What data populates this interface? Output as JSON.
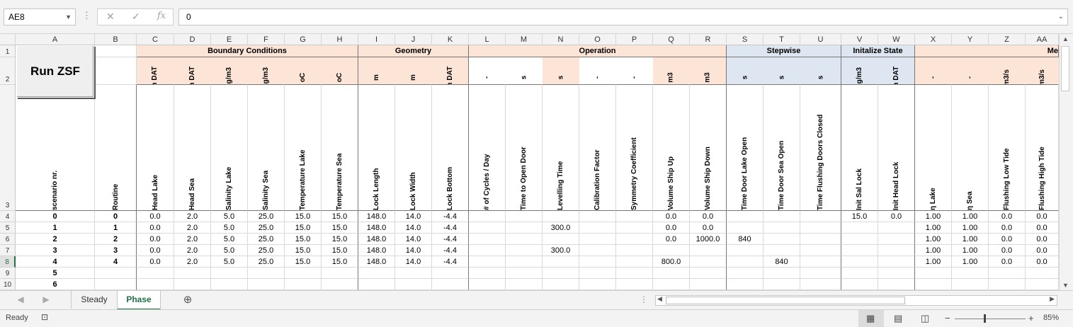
{
  "namebox": "AE8",
  "formula_value": "0",
  "fx_label": "fx",
  "columns": [
    "A",
    "B",
    "C",
    "D",
    "E",
    "F",
    "G",
    "H",
    "I",
    "J",
    "K",
    "L",
    "M",
    "N",
    "O",
    "P",
    "Q",
    "R",
    "S",
    "T",
    "U",
    "V",
    "W",
    "X",
    "Y",
    "Z",
    "AA"
  ],
  "row_numbers": [
    "1",
    "2",
    "3",
    "4",
    "5",
    "6",
    "7",
    "8",
    "9",
    "10"
  ],
  "run_button": "Run ZSF",
  "groups": [
    {
      "label": "Boundary Conditions"
    },
    {
      "label": "Geometry"
    },
    {
      "label": "Operation"
    },
    {
      "label": "Stepwise"
    },
    {
      "label": "Initalize State"
    },
    {
      "label": "Me"
    }
  ],
  "units": [
    "m DAT",
    "m DAT",
    "kg/m3",
    "kg/m3",
    "oC",
    "oC",
    "m",
    "m",
    "m DAT",
    "-",
    "s",
    "s",
    "-",
    "-",
    "m3",
    "m3",
    "s",
    "s",
    "s",
    "kg/m3",
    "m DAT",
    "-",
    "-",
    "m3/s",
    "m3/s"
  ],
  "titles": [
    "scenario nr.",
    "Routine",
    "Head Lake",
    "Head Sea",
    "Salinity Lake",
    "Salinity Sea",
    "Temperature Lake",
    "Temperature Sea",
    "Lock Length",
    "Lock Width",
    "Lock Bottom",
    "# of Cycles / Day",
    "Time to Open Door",
    "Levelling Time",
    "Calibration Factor",
    "Symmetry Coefficient",
    "Volume Ship Up",
    "Volume Ship Down",
    "Time Door Lake Open",
    "Time Door Sea Open",
    "Time Flushing Doors Closed",
    "Init Sal Lock",
    "Init Head Lock",
    "η Lake",
    "η Sea",
    "Flushing Low Tide",
    "Flushing High Tide"
  ],
  "rows": [
    [
      "0",
      "0",
      "0.0",
      "2.0",
      "5.0",
      "25.0",
      "15.0",
      "15.0",
      "148.0",
      "14.0",
      "-4.4",
      "",
      "",
      "",
      "",
      "",
      "0.0",
      "0.0",
      "",
      "",
      "",
      "15.0",
      "0.0",
      "1.00",
      "1.00",
      "0.0",
      "0.0"
    ],
    [
      "1",
      "1",
      "0.0",
      "2.0",
      "5.0",
      "25.0",
      "15.0",
      "15.0",
      "148.0",
      "14.0",
      "-4.4",
      "",
      "",
      "300.0",
      "",
      "",
      "0.0",
      "0.0",
      "",
      "",
      "",
      "",
      "",
      "1.00",
      "1.00",
      "0.0",
      "0.0"
    ],
    [
      "2",
      "2",
      "0.0",
      "2.0",
      "5.0",
      "25.0",
      "15.0",
      "15.0",
      "148.0",
      "14.0",
      "-4.4",
      "",
      "",
      "",
      "",
      "",
      "0.0",
      "1000.0",
      "840",
      "",
      "",
      "",
      "",
      "1.00",
      "1.00",
      "0.0",
      "0.0"
    ],
    [
      "3",
      "3",
      "0.0",
      "2.0",
      "5.0",
      "25.0",
      "15.0",
      "15.0",
      "148.0",
      "14.0",
      "-4.4",
      "",
      "",
      "300.0",
      "",
      "",
      "",
      "",
      "",
      "",
      "",
      "",
      "",
      "1.00",
      "1.00",
      "0.0",
      "0.0"
    ],
    [
      "4",
      "4",
      "0.0",
      "2.0",
      "5.0",
      "25.0",
      "15.0",
      "15.0",
      "148.0",
      "14.0",
      "-4.4",
      "",
      "",
      "",
      "",
      "",
      "800.0",
      "",
      "",
      "840",
      "",
      "",
      "",
      "1.00",
      "1.00",
      "0.0",
      "0.0"
    ],
    [
      "5",
      "",
      "",
      "",
      "",
      "",
      "",
      "",
      "",
      "",
      "",
      "",
      "",
      "",
      "",
      "",
      "",
      "",
      "",
      "",
      "",
      "",
      "",
      "",
      "",
      "",
      ""
    ],
    [
      "6",
      "",
      "",
      "",
      "",
      "",
      "",
      "",
      "",
      "",
      "",
      "",
      "",
      "",
      "",
      "",
      "",
      "",
      "",
      "",
      "",
      "",
      "",
      "",
      "",
      "",
      ""
    ]
  ],
  "tabs": {
    "steady": "Steady",
    "phase": "Phase"
  },
  "status": {
    "ready": "Ready",
    "zoom": "85%"
  },
  "colors": {
    "peach": "#fce4d6",
    "blue": "#dde6f1",
    "tab_green": "#1e7145"
  }
}
